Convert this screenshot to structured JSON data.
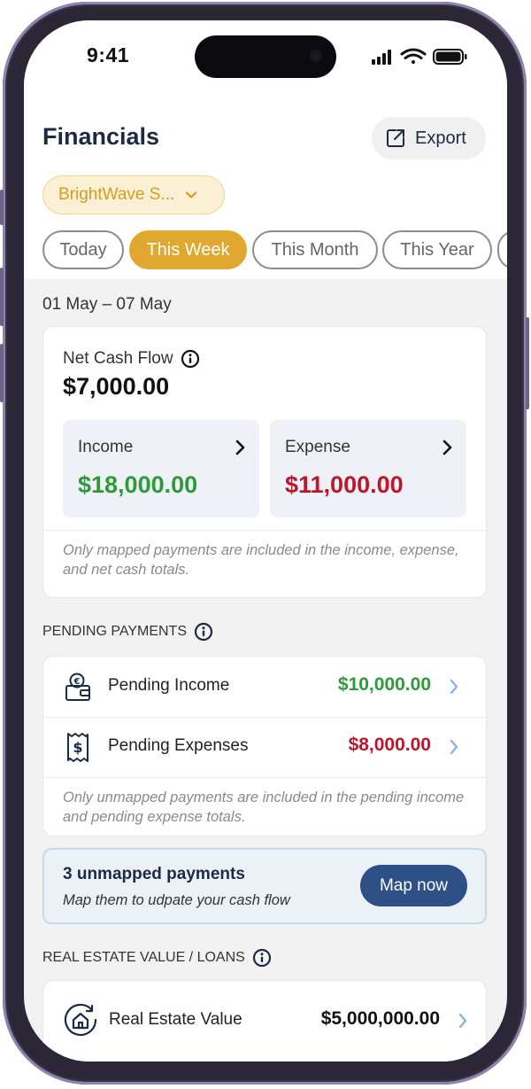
{
  "status_bar": {
    "time": "9:41"
  },
  "header": {
    "title": "Financials",
    "export_label": "Export"
  },
  "company_selector": {
    "label": "BrightWave S..."
  },
  "period_tabs": [
    {
      "label": "Today",
      "active": false
    },
    {
      "label": "This Week",
      "active": true
    },
    {
      "label": "This Month",
      "active": false
    },
    {
      "label": "This Year",
      "active": false
    }
  ],
  "date_range": "01 May – 07 May",
  "net_cash_flow": {
    "label": "Net Cash Flow",
    "value": "$7,000.00",
    "income": {
      "label": "Income",
      "value": "$18,000.00"
    },
    "expense": {
      "label": "Expense",
      "value": "$11,000.00"
    },
    "note": "Only mapped payments are included in the income, expense, and net cash totals."
  },
  "pending": {
    "header": "PENDING PAYMENTS",
    "income": {
      "label": "Pending Income",
      "value": "$10,000.00"
    },
    "expenses": {
      "label": "Pending Expenses",
      "value": "$8,000.00"
    },
    "note": "Only unmapped payments are included in the pending income and pending expense totals."
  },
  "unmapped_banner": {
    "title": "3 unmapped payments",
    "subtitle": "Map them to udpate your cash flow",
    "button_label": "Map now"
  },
  "real_estate": {
    "header": "REAL ESTATE VALUE / LOANS",
    "label": "Real Estate Value",
    "value": "$5,000,000.00"
  },
  "colors": {
    "accent": "#e0a82e",
    "positive": "#2e9a3a",
    "negative": "#c0162c",
    "primary_button": "#2d5087",
    "navy_text": "#1c2a44"
  }
}
